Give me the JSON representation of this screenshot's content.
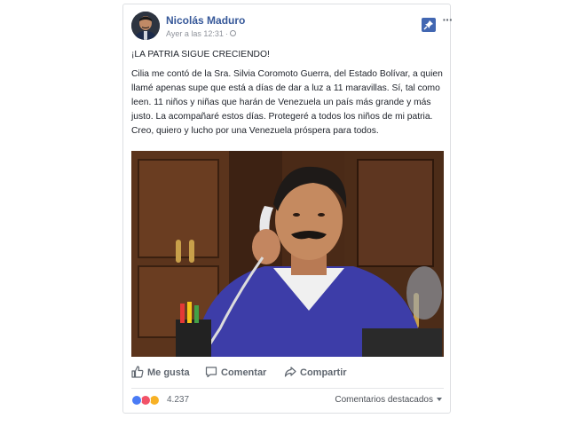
{
  "post": {
    "author": "Nicolás Maduro",
    "timestamp": "Ayer a las 12:31",
    "separator": "·",
    "title": "¡LA PATRIA SIGUE CRECIENDO!",
    "body": "Cilia me contó de la Sra. Silvia Coromoto Guerra, del Estado Bolívar, a quien llamé apenas supe que está a días de dar a luz a 11 maravillas. Sí, tal como leen. 11 niños y niñas que harán de Venezuela un país más grande y más justo. La acompañaré estos días. Protegeré a todos los niños de mi patria. Creo, quiero y lucho por una Venezuela próspera para todos."
  },
  "actions": {
    "like": "Me gusta",
    "comment": "Comentar",
    "share": "Compartir"
  },
  "reactions": {
    "count": "4.237",
    "icons": [
      "like-reaction",
      "love-reaction",
      "sad-reaction"
    ]
  },
  "comments": {
    "filter": "Comentarios destacados"
  },
  "colors": {
    "author_link": "#365899",
    "accent": "#4267b2",
    "secondary_text": "#90949c"
  }
}
